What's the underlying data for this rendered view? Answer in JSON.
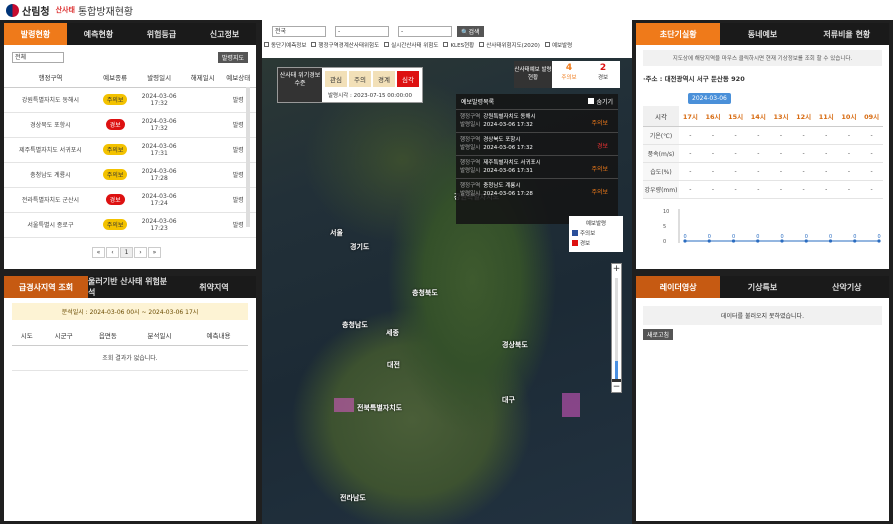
{
  "header": {
    "org": "산림청",
    "brand": "산사태",
    "title": "통합방재현황"
  },
  "left_top": {
    "tabs": [
      "발령현황",
      "예측현황",
      "위험등급",
      "신고정보"
    ],
    "region_select": "전체",
    "issue_btn": "발령지도",
    "columns": [
      "행정구역",
      "예보종류",
      "발령일시",
      "해제일시",
      "예보상태"
    ],
    "rows": [
      {
        "region": "강원특별자치도 동해시",
        "type": "주의보",
        "kind": "w",
        "date": "2024-03-06",
        "time": "17:32",
        "status": "발령"
      },
      {
        "region": "경상북도 포항시",
        "type": "경보",
        "kind": "a",
        "date": "2024-03-06",
        "time": "17:32",
        "status": "발령"
      },
      {
        "region": "제주특별자치도 서귀포시",
        "type": "주의보",
        "kind": "w",
        "date": "2024-03-06",
        "time": "17:31",
        "status": "발령"
      },
      {
        "region": "충청남도 계룡시",
        "type": "주의보",
        "kind": "w",
        "date": "2024-03-06",
        "time": "17:28",
        "status": "발령"
      },
      {
        "region": "전라특별자치도 군산시",
        "type": "경보",
        "kind": "a",
        "date": "2024-03-06",
        "time": "17:24",
        "status": "발령"
      },
      {
        "region": "서울특별시 종로구",
        "type": "주의보",
        "kind": "w",
        "date": "2024-03-06",
        "time": "17:23",
        "status": "발령"
      }
    ],
    "pager": [
      "«",
      "‹",
      "1",
      "›",
      "»"
    ]
  },
  "left_bottom": {
    "tabs": [
      "급경사지역 조회",
      "울러기반 산사태 위험분석",
      "취약지역"
    ],
    "time_range": "분석일시 : 2024-03-06 00시 ~ 2024-03-06 17시",
    "columns": [
      "시도",
      "시군구",
      "읍면동",
      "분석일시",
      "예측내용"
    ],
    "empty": "조회 결과가 없습니다."
  },
  "map": {
    "selects": [
      "전국",
      "-",
      "-"
    ],
    "search_btn": "검색",
    "layers": [
      "동단기예측정보",
      "행정구역경계산사태위험도",
      "실시간산사태 위험도",
      "KLES현황",
      "산사태위험지도(2020)",
      "예보발령"
    ],
    "level_label": "산사태 위기경보 수준",
    "levels": [
      {
        "t": "관심",
        "c": "#f2e0b8"
      },
      {
        "t": "주의",
        "c": "#f2e0b8"
      },
      {
        "t": "경계",
        "c": "#f2e0b8"
      },
      {
        "t": "심각",
        "c": "#d11"
      }
    ],
    "level_time": "발령시각 : 2023-07-15 00:00:00",
    "count_label": "산사태예보 발령현황",
    "watch_count": "4",
    "watch_label": "주의보",
    "alarm_count": "2",
    "alarm_label": "경보",
    "popup_title": "예보발령목록",
    "popup_hide": "숨기기",
    "popup_rows": [
      {
        "r": "강원특별자치도 동해시",
        "d": "2024-03-06 17:32",
        "s": "주의보",
        "a": false
      },
      {
        "r": "경상북도 포항시",
        "d": "2024-03-06 17:32",
        "s": "경보",
        "a": true
      },
      {
        "r": "제주특별자치도 서귀포시",
        "d": "2024-03-06 17:31",
        "s": "주의보",
        "a": false
      },
      {
        "r": "충청남도 계룡시",
        "d": "2024-03-06 17:28",
        "s": "주의보",
        "a": false
      }
    ],
    "row_k1": "행정구역",
    "row_k2": "발령일시",
    "legend_title": "예보발령",
    "legend": [
      {
        "t": "주의보",
        "c": "#2a4f9a"
      },
      {
        "t": "경보",
        "c": "#d11"
      }
    ],
    "cities": [
      {
        "t": "강원특별자치도",
        "l": 192,
        "tp": 192
      },
      {
        "t": "경기도",
        "l": 88,
        "tp": 242
      },
      {
        "t": "서울",
        "l": 68,
        "tp": 228
      },
      {
        "t": "충청북도",
        "l": 150,
        "tp": 288
      },
      {
        "t": "경상북도",
        "l": 240,
        "tp": 340
      },
      {
        "t": "충청남도",
        "l": 80,
        "tp": 320
      },
      {
        "t": "세종",
        "l": 124,
        "tp": 328
      },
      {
        "t": "대전",
        "l": 125,
        "tp": 360
      },
      {
        "t": "전북특별자치도",
        "l": 95,
        "tp": 403
      },
      {
        "t": "대구",
        "l": 240,
        "tp": 395
      },
      {
        "t": "전라남도",
        "l": 78,
        "tp": 493
      }
    ]
  },
  "right_top": {
    "tabs": [
      "초단기실황",
      "동네예보",
      "저류비율 현황"
    ],
    "note": "지도상에 해당지역을 마우스 클릭하시면 현재 기상정보를 조회 할 수 있습니다.",
    "address": "주소 : 대전광역시 서구 둔산동 920",
    "date": "2024-03-06",
    "hours": [
      "17시",
      "16시",
      "15시",
      "14시",
      "13시",
      "12시",
      "11시",
      "10시",
      "09시"
    ],
    "rows": [
      "기온(℃)",
      "풍속(m/s)",
      "습도(%)",
      "강우량(mm)"
    ],
    "row_key": "시각"
  },
  "chart_data": {
    "type": "line",
    "ylim": [
      0,
      10
    ],
    "yticks": [
      "10",
      "5",
      "0"
    ],
    "x": [
      "17시",
      "16시",
      "15시",
      "14시",
      "13시",
      "12시",
      "11시",
      "10시",
      "09시"
    ],
    "values": [
      0,
      0,
      0,
      0,
      0,
      0,
      0,
      0,
      0
    ]
  },
  "right_bottom": {
    "tabs": [
      "레이더영상",
      "기상특보",
      "산악기상"
    ],
    "msg": "데이터를 불러오지 못하였습니다.",
    "btn": "새로고침"
  }
}
